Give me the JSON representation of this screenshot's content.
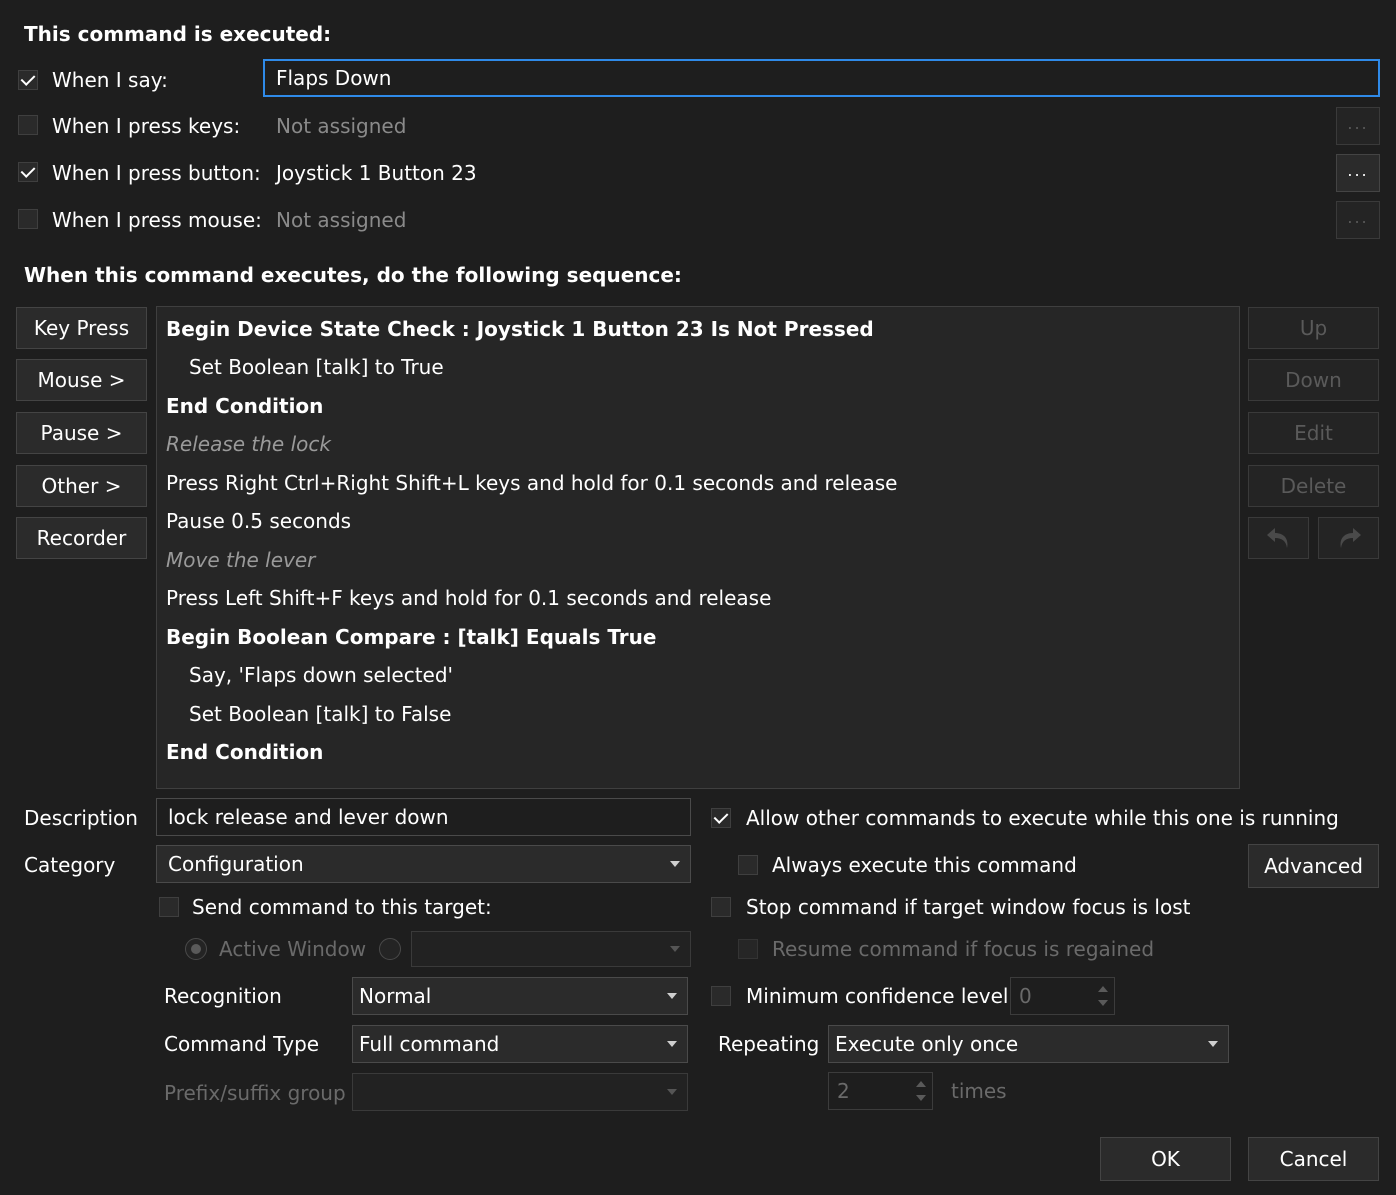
{
  "header": {
    "executed_title": "This command is executed:"
  },
  "triggers": {
    "say": {
      "label": "When I say:",
      "checked": true,
      "value": "Flaps Down"
    },
    "keys": {
      "label": "When I press keys:",
      "checked": false,
      "value": "Not assigned",
      "button": "..."
    },
    "button": {
      "label": "When I press button:",
      "checked": true,
      "value": "Joystick 1 Button 23",
      "button": "..."
    },
    "mouse": {
      "label": "When I press mouse:",
      "checked": false,
      "value": "Not assigned",
      "button": "..."
    }
  },
  "sequence": {
    "title": "When this command executes, do the following sequence:",
    "left_buttons": [
      "Key Press",
      "Mouse >",
      "Pause >",
      "Other >",
      "Recorder"
    ],
    "right_buttons": [
      "Up",
      "Down",
      "Edit",
      "Delete"
    ],
    "undo_icon": "undo-arrow-icon",
    "redo_icon": "redo-arrow-icon",
    "lines": [
      {
        "text": "Begin Device State Check :  Joystick 1 Button 23 Is Not Pressed",
        "style": "bold",
        "indent": 0
      },
      {
        "text": "Set Boolean [talk] to True",
        "style": "normal",
        "indent": 1
      },
      {
        "text": "End Condition",
        "style": "bold",
        "indent": 0
      },
      {
        "text": "Release the lock",
        "style": "italic",
        "indent": 0
      },
      {
        "text": "Press Right Ctrl+Right Shift+L keys and hold for 0.1 seconds and release",
        "style": "normal",
        "indent": 0
      },
      {
        "text": "Pause 0.5 seconds",
        "style": "normal",
        "indent": 0
      },
      {
        "text": "Move the lever",
        "style": "italic",
        "indent": 0
      },
      {
        "text": "Press Left Shift+F keys and hold for 0.1 seconds and release",
        "style": "normal",
        "indent": 0
      },
      {
        "text": "Begin Boolean Compare : [talk] Equals True",
        "style": "bold",
        "indent": 0
      },
      {
        "text": "Say, 'Flaps down selected'",
        "style": "normal",
        "indent": 1
      },
      {
        "text": "Set Boolean [talk] to False",
        "style": "normal",
        "indent": 1
      },
      {
        "text": "End Condition",
        "style": "bold",
        "indent": 0
      }
    ]
  },
  "options": {
    "description_label": "Description",
    "description_value": "lock release and lever down",
    "category_label": "Category",
    "category_value": "Configuration",
    "allow_other": {
      "label": "Allow other commands to execute while this one is running",
      "checked": true
    },
    "always_execute": {
      "label": "Always execute this command",
      "checked": false
    },
    "advanced_button": "Advanced",
    "send_target": {
      "label": "Send command to this target:",
      "checked": false
    },
    "active_window": "Active Window",
    "stop_focus": {
      "label": "Stop command if target window focus is lost",
      "checked": false
    },
    "resume_focus": {
      "label": "Resume command if focus is regained",
      "checked": false
    },
    "recognition_label": "Recognition",
    "recognition_value": "Normal",
    "min_confidence": {
      "label": "Minimum confidence level",
      "checked": false,
      "value": "0"
    },
    "command_type_label": "Command Type",
    "command_type_value": "Full command",
    "repeating_label": "Repeating",
    "repeating_value": "Execute only once",
    "prefix_label": "Prefix/suffix group",
    "repeat_count": "2",
    "times_label": "times"
  },
  "footer": {
    "ok": "OK",
    "cancel": "Cancel"
  },
  "colors": {
    "background": "#1e1e1e",
    "focus_border": "#2f8ae8",
    "panel": "#262626"
  }
}
